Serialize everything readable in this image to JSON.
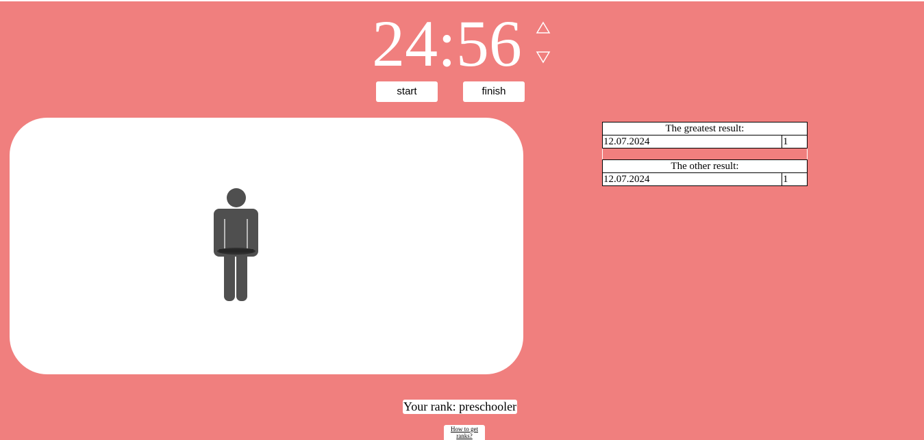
{
  "timer": {
    "display": "24:56"
  },
  "controls": {
    "start_label": "start",
    "finish_label": "finish",
    "increase_icon": "triangle-up-outline-icon",
    "decrease_icon": "triangle-down-outline-icon"
  },
  "stage": {
    "figure_icon": "person-figure-icon"
  },
  "results": {
    "greatest": {
      "title": "The greatest result:",
      "rows": [
        {
          "date": "12.07.2024",
          "value": "1"
        }
      ]
    },
    "other": {
      "title": "The other result:",
      "rows": [
        {
          "date": "12.07.2024",
          "value": "1"
        }
      ]
    }
  },
  "rank": {
    "text": "Your rank: preschooler"
  },
  "help": {
    "link_text": "How to get ranks?"
  },
  "colors": {
    "background": "#f07f7e",
    "panel": "#ffffff",
    "figure": "#4f4f4f"
  }
}
